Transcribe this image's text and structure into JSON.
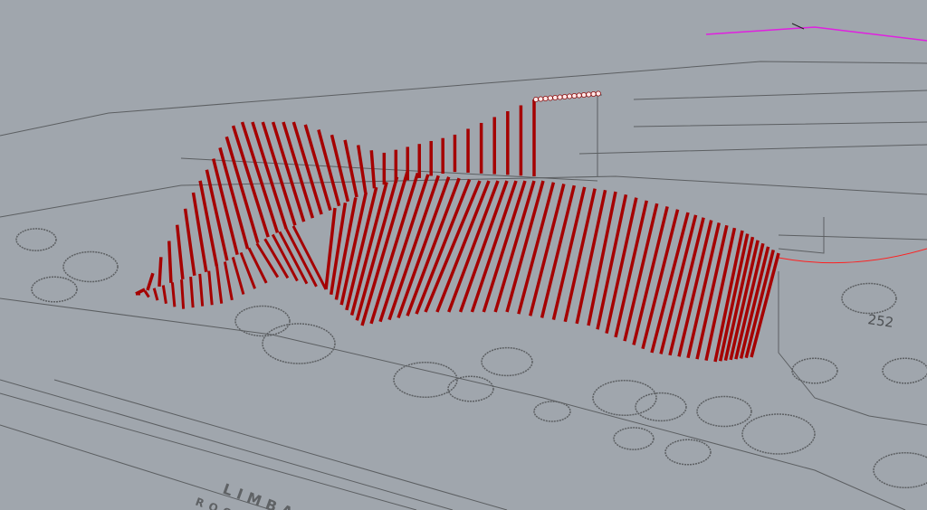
{
  "viewport": {
    "background": "#a0a6ad",
    "surface_color": "#a50000",
    "plan_line_color": "#5c5f62",
    "curve_magenta": "#e020e0",
    "curve_red": "#ff2020",
    "control_point_color": "#ffe8e8"
  },
  "plan_labels": {
    "street": "LIMBAR",
    "room": "ROOM",
    "number": "252"
  }
}
